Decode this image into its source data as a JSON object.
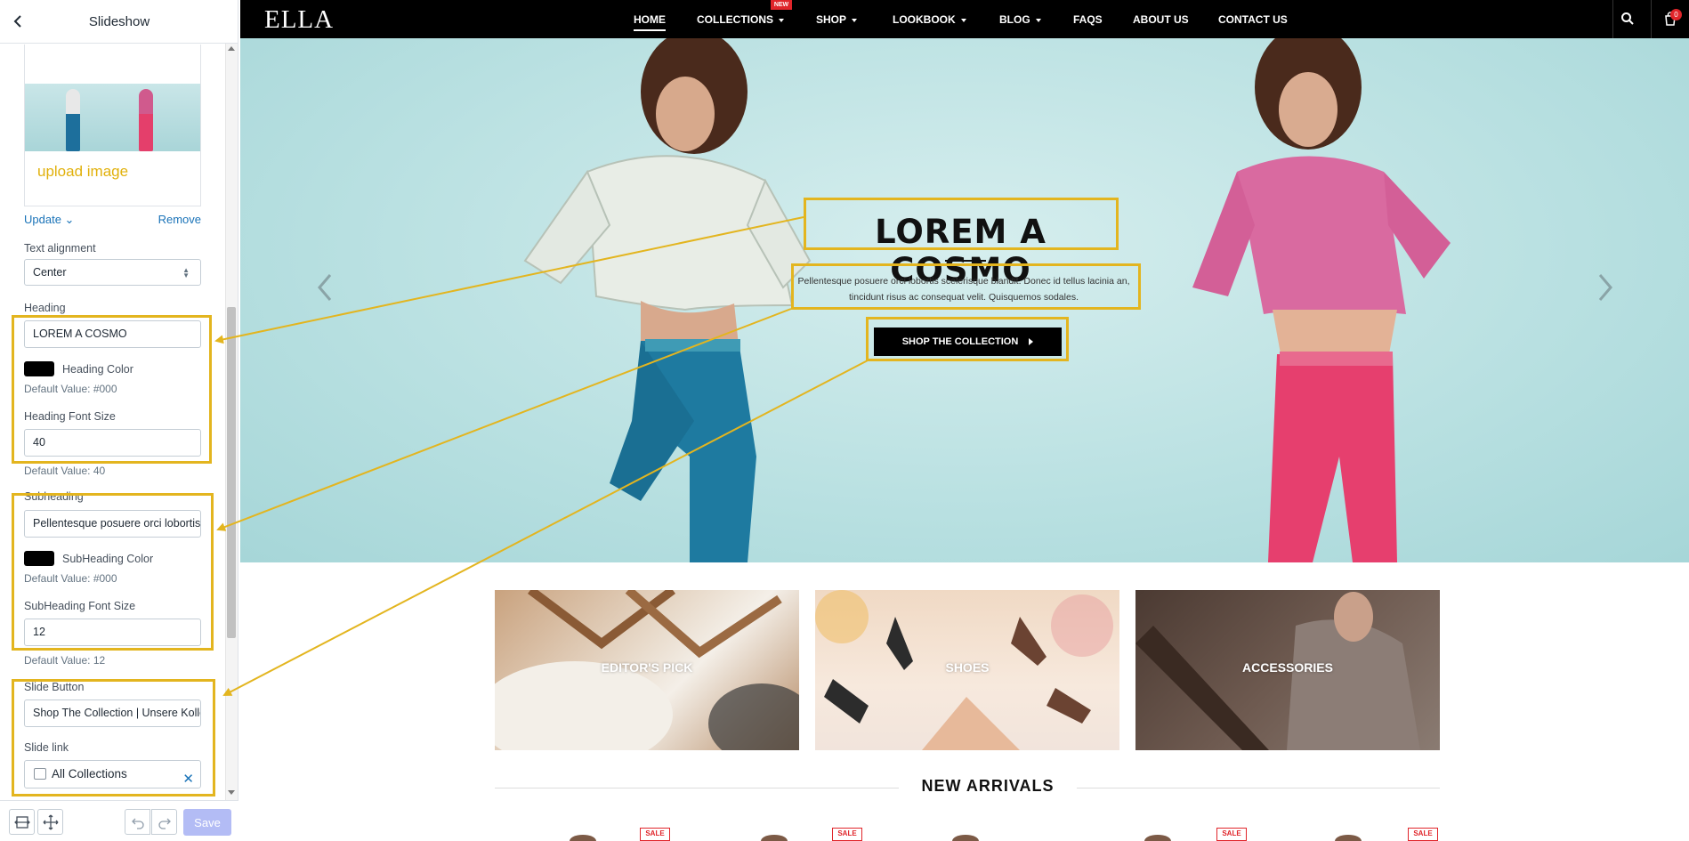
{
  "panel": {
    "title": "Slideshow",
    "upload_image": "upload image",
    "update_label": "Update",
    "remove_label": "Remove",
    "text_alignment_label": "Text alignment",
    "text_alignment_value": "Center",
    "heading_label": "Heading",
    "heading_value": "LOREM A COSMO",
    "heading_color_label": "Heading Color",
    "heading_color_default": "Default Value: #000",
    "heading_font_size_label": "Heading Font Size",
    "heading_font_size_value": "40",
    "heading_font_size_default": "Default Value: 40",
    "subheading_label": "Subheading",
    "subheading_value": "Pellentesque posuere orci lobortis scelerisque blandit.",
    "subheading_color_label": "SubHeading Color",
    "subheading_color_default": "Default Value: #000",
    "subheading_font_size_label": "SubHeading Font Size",
    "subheading_font_size_value": "12",
    "subheading_font_size_default": "Default Value: 12",
    "slide_button_label": "Slide Button",
    "slide_button_value": "Shop The Collection |  Unsere Kollektion",
    "slide_link_label": "Slide link",
    "slide_link_value": "All Collections",
    "save_label": "Save",
    "heading_color": "#000000",
    "subheading_color": "#000000",
    "highlight_color": "#e3b51f"
  },
  "store": {
    "logo": "ELLA",
    "nav": [
      {
        "label": "HOME"
      },
      {
        "label": "COLLECTIONS"
      },
      {
        "label": "SHOP"
      },
      {
        "label": "LOOKBOOK"
      },
      {
        "label": "BLOG"
      },
      {
        "label": "FAQS"
      },
      {
        "label": "ABOUT US"
      },
      {
        "label": "CONTACT US"
      }
    ],
    "new_badge": "NEW",
    "cart_count": "0",
    "hero": {
      "title": "LOREM A COSMO",
      "subtitle": "Pellentesque posuere orci lobortis scelerisque blandit. Donec id tellus lacinia an, tincidunt risus ac consequat velit. Quisquemos sodales.",
      "button": "SHOP THE COLLECTION"
    },
    "categories": [
      {
        "label": "EDITOR'S PICK"
      },
      {
        "label": "SHOES"
      },
      {
        "label": "ACCESSORIES"
      }
    ],
    "new_arrivals": "NEW ARRIVALS",
    "sale_badge": "SALE"
  }
}
